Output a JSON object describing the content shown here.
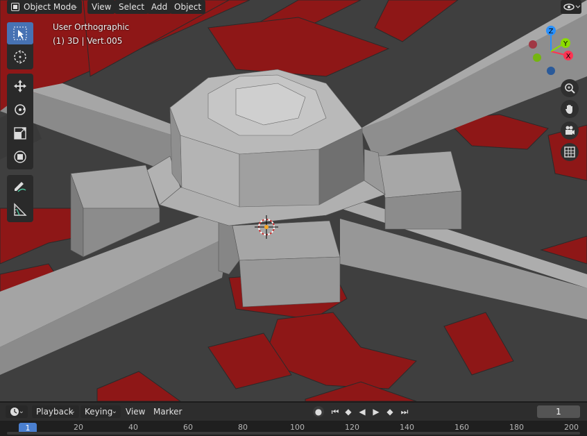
{
  "header": {
    "mode_label": "Object Mode",
    "menus": [
      "View",
      "Select",
      "Add",
      "Object"
    ]
  },
  "overlay": {
    "view_name": "User Orthographic",
    "object_info": "(1) 3D | Vert.005"
  },
  "toolbar": {
    "tools": [
      "select-box",
      "cursor",
      "move",
      "rotate",
      "scale",
      "transform",
      "annotate",
      "measure"
    ],
    "active_tool": "select-box"
  },
  "gizmo": {
    "axes": {
      "x": "X",
      "y": "Y",
      "z": "Z"
    },
    "colors": {
      "x": "#ff3352",
      "y": "#8bdc00",
      "z": "#2890ff"
    }
  },
  "colors": {
    "background": "#3f3f3f",
    "floor_red": "#8e1717",
    "mesh_light": "#a4a4a4",
    "active_tool": "#4772b3"
  },
  "timeline": {
    "menus": [
      "Playback",
      "Keying",
      "View",
      "Marker"
    ],
    "current_frame": "1",
    "ruler_current": "1",
    "ruler_ticks": [
      "20",
      "40",
      "60",
      "80",
      "100",
      "120",
      "140",
      "160",
      "180",
      "200"
    ]
  }
}
